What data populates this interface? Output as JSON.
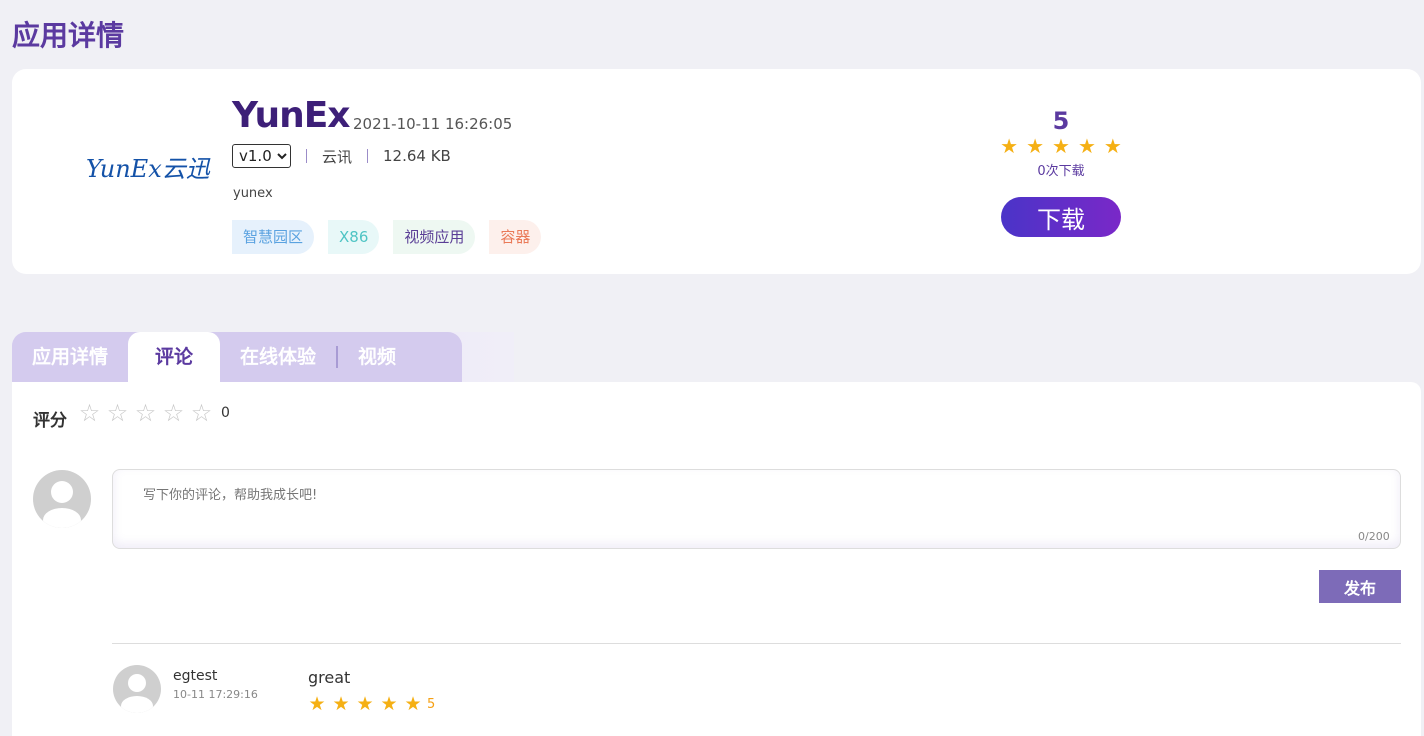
{
  "page_title": "应用详情",
  "app": {
    "logo_text": "YunEx云迅",
    "name": "YunEx",
    "updated": "2021-10-11 16:26:05",
    "version_selected": "v1.0",
    "vendor": "云讯",
    "size": "12.64 KB",
    "description": "yunex",
    "tags": [
      "智慧园区",
      "X86",
      "视频应用",
      "容器"
    ]
  },
  "rating": {
    "score": "5",
    "stars_filled": 5,
    "stars_total": 5,
    "downloads": "0次下载",
    "download_button": "下载"
  },
  "tabs": [
    "应用详情",
    "评论",
    "在线体验",
    "视频"
  ],
  "active_tab": "评论",
  "review_form": {
    "score_label": "评分",
    "score_value": "0",
    "placeholder": "写下你的评论，帮助我成长吧!",
    "counter": "0/200",
    "publish_button": "发布"
  },
  "comments": [
    {
      "user": "egtest",
      "time": "10-11 17:29:16",
      "text": "great",
      "stars": 5,
      "score": "5"
    }
  ],
  "colors": {
    "accent": "#5b3aa0",
    "star": "#f5b014",
    "publish": "#7d6bb8"
  }
}
